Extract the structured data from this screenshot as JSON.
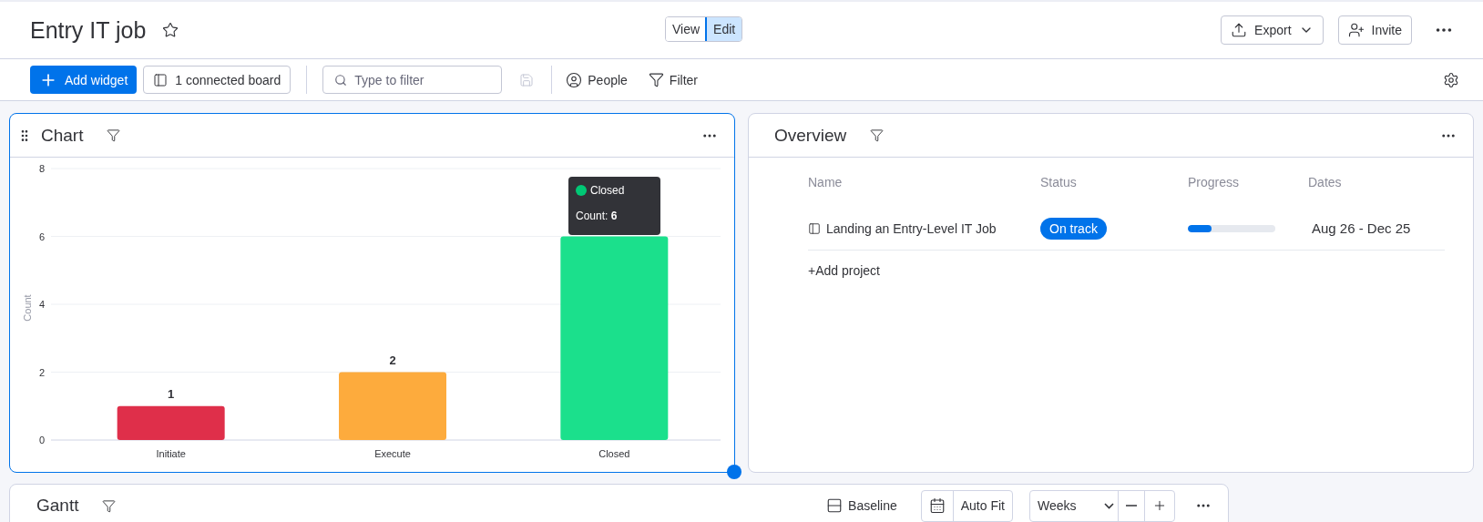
{
  "header": {
    "title": "Entry IT job",
    "view_modes": [
      {
        "label": "View",
        "selected": false
      },
      {
        "label": "Edit",
        "selected": true
      }
    ],
    "export_label": "Export",
    "invite_label": "Invite"
  },
  "toolbar": {
    "add_widget": "Add widget",
    "connected_board": "1 connected board",
    "filter_placeholder": "Type to filter",
    "people": "People",
    "filter": "Filter"
  },
  "chart_widget": {
    "title": "Chart",
    "selected": true,
    "chart_data": {
      "type": "bar",
      "ylabel": "Count",
      "categories": [
        "Initiate",
        "Execute",
        "Closed"
      ],
      "series": [
        {
          "values": [
            1,
            2,
            6
          ]
        }
      ],
      "grid": true,
      "colors": [
        "#df2f4a",
        "#fdab3d",
        "#1be08c"
      ],
      "ylim": [
        0,
        8
      ],
      "yticks": [
        0,
        2,
        4,
        6,
        8
      ],
      "value_labels": [
        "1",
        "2",
        null
      ]
    },
    "tooltip": {
      "label": "Closed",
      "color": "#00c875",
      "count_label": "Count:",
      "count": "6"
    }
  },
  "overview_widget": {
    "title": "Overview",
    "columns": [
      "Name",
      "Status",
      "Progress",
      "Dates"
    ],
    "rows": [
      {
        "name": "Landing an Entry-Level IT Job",
        "status": "On track",
        "color": "#0073ea",
        "progress": {
          "level": 0.27
        },
        "dates": "Aug 26 - Dec 25"
      }
    ],
    "add_project": "+Add project"
  },
  "gantt_widget": {
    "title": "Gantt",
    "baseline": "Baseline",
    "auto_fit": "Auto Fit",
    "scale": "Weeks"
  }
}
